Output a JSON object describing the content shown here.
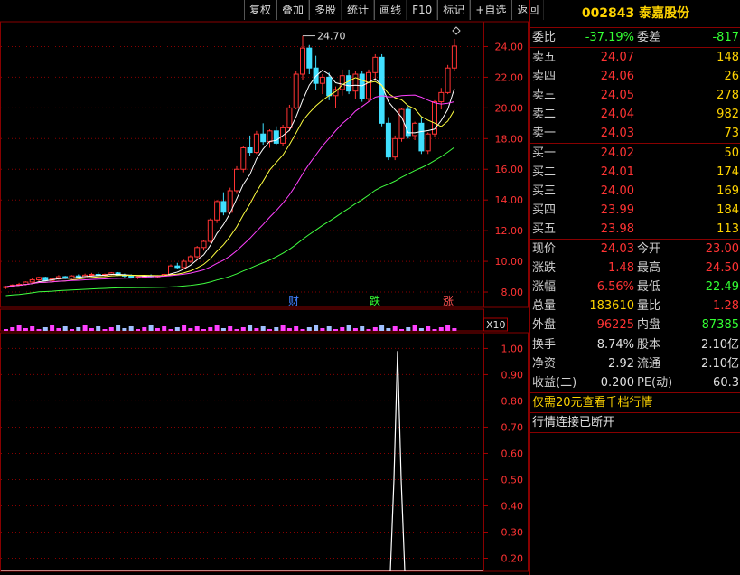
{
  "toolbar": {
    "items": [
      "复权",
      "叠加",
      "多股",
      "统计",
      "画线",
      "F10",
      "标记",
      "+自选",
      "返回"
    ]
  },
  "chart": {
    "max_label": "24.70",
    "diamond_icon": "diamond-icon",
    "price_axis": [
      "24.00",
      "22.00",
      "20.00",
      "18.00",
      "16.00",
      "14.00",
      "12.00",
      "10.00",
      "8.00"
    ],
    "event_tags": [
      {
        "text": "财",
        "color": "#4080ff"
      },
      {
        "text": "跌",
        "color": "#33ff33"
      },
      {
        "text": "涨",
        "color": "#ff5050"
      }
    ],
    "lower_panel_label": "X10",
    "lower_axis": [
      "1.00",
      "0.90",
      "0.80",
      "0.70",
      "0.60",
      "0.50",
      "0.40",
      "0.30",
      "0.20"
    ],
    "colors": {
      "up": "#ff3333",
      "down": "#40e0ff",
      "ma5": "#ffffff",
      "ma10": "#ffff40",
      "ma20": "#ff40ff",
      "ma60": "#40ff40"
    }
  },
  "chart_data": {
    "type": "candlestick",
    "ylim": [
      7.0,
      25.5
    ],
    "candles": [
      [
        8.3,
        8.4,
        8.2,
        8.35
      ],
      [
        8.35,
        8.5,
        8.3,
        8.45
      ],
      [
        8.45,
        8.6,
        8.4,
        8.5
      ],
      [
        8.5,
        8.7,
        8.45,
        8.65
      ],
      [
        8.65,
        8.9,
        8.6,
        8.8
      ],
      [
        8.8,
        9.0,
        8.7,
        8.95
      ],
      [
        8.95,
        9.0,
        8.7,
        8.75
      ],
      [
        8.75,
        8.9,
        8.7,
        8.85
      ],
      [
        8.85,
        9.1,
        8.8,
        9.0
      ],
      [
        9.0,
        9.05,
        8.85,
        8.9
      ],
      [
        8.9,
        9.1,
        8.85,
        9.05
      ],
      [
        9.05,
        9.15,
        8.95,
        9.0
      ],
      [
        9.0,
        9.2,
        8.95,
        9.1
      ],
      [
        9.1,
        9.25,
        9.0,
        9.15
      ],
      [
        9.15,
        9.3,
        9.05,
        9.1
      ],
      [
        9.1,
        9.2,
        9.0,
        9.15
      ],
      [
        9.15,
        9.3,
        9.1,
        9.25
      ],
      [
        9.25,
        9.3,
        9.05,
        9.1
      ],
      [
        9.1,
        9.2,
        8.95,
        9.05
      ],
      [
        9.05,
        9.15,
        8.9,
        8.95
      ],
      [
        8.95,
        9.05,
        8.85,
        9.0
      ],
      [
        9.0,
        9.1,
        8.9,
        9.05
      ],
      [
        9.05,
        9.15,
        8.95,
        9.0
      ],
      [
        9.0,
        9.1,
        8.9,
        9.05
      ],
      [
        9.05,
        9.2,
        9.0,
        9.15
      ],
      [
        9.15,
        9.8,
        9.1,
        9.7
      ],
      [
        9.7,
        9.9,
        9.5,
        9.6
      ],
      [
        9.6,
        10.1,
        9.55,
        10.0
      ],
      [
        10.0,
        10.4,
        9.9,
        10.3
      ],
      [
        10.3,
        11.0,
        10.2,
        10.9
      ],
      [
        10.9,
        11.4,
        10.7,
        11.3
      ],
      [
        11.3,
        12.8,
        11.2,
        12.7
      ],
      [
        12.7,
        14.0,
        12.5,
        13.9
      ],
      [
        13.9,
        14.5,
        13.0,
        13.2
      ],
      [
        13.2,
        14.8,
        13.1,
        14.6
      ],
      [
        14.6,
        16.2,
        14.4,
        16.0
      ],
      [
        16.0,
        17.5,
        15.8,
        17.4
      ],
      [
        17.4,
        18.2,
        16.9,
        17.1
      ],
      [
        17.1,
        18.5,
        17.0,
        18.3
      ],
      [
        18.3,
        19.0,
        17.6,
        17.8
      ],
      [
        17.8,
        18.6,
        17.4,
        18.5
      ],
      [
        18.5,
        18.8,
        17.6,
        17.7
      ],
      [
        17.7,
        18.9,
        17.5,
        18.7
      ],
      [
        18.7,
        20.2,
        18.5,
        20.0
      ],
      [
        20.0,
        22.4,
        19.9,
        22.2
      ],
      [
        22.2,
        24.7,
        21.8,
        23.9
      ],
      [
        23.9,
        24.1,
        22.2,
        22.6
      ],
      [
        22.6,
        23.4,
        21.2,
        21.6
      ],
      [
        21.6,
        22.2,
        20.9,
        22.0
      ],
      [
        22.0,
        22.3,
        20.5,
        20.8
      ],
      [
        20.8,
        21.4,
        20.0,
        21.2
      ],
      [
        21.2,
        22.5,
        20.8,
        22.1
      ],
      [
        22.1,
        22.5,
        20.9,
        21.1
      ],
      [
        21.1,
        22.4,
        20.6,
        22.2
      ],
      [
        22.2,
        22.4,
        20.4,
        20.6
      ],
      [
        20.6,
        22.5,
        20.4,
        22.3
      ],
      [
        22.3,
        23.5,
        21.8,
        23.3
      ],
      [
        23.3,
        23.5,
        18.8,
        19.0
      ],
      [
        19.0,
        19.4,
        16.6,
        16.8
      ],
      [
        16.8,
        18.2,
        16.6,
        18.0
      ],
      [
        18.0,
        20.0,
        17.8,
        19.9
      ],
      [
        19.9,
        20.1,
        18.0,
        18.2
      ],
      [
        18.2,
        19.1,
        17.9,
        19.0
      ],
      [
        19.0,
        19.4,
        17.0,
        17.2
      ],
      [
        17.2,
        18.4,
        17.0,
        18.3
      ],
      [
        18.3,
        20.5,
        18.1,
        20.4
      ],
      [
        20.4,
        21.3,
        19.9,
        21.0
      ],
      [
        21.0,
        22.8,
        20.9,
        22.6
      ],
      [
        22.6,
        24.5,
        22.4,
        24.03
      ]
    ],
    "markers": [
      [
        0.95,
        0.01
      ]
    ]
  },
  "quote": {
    "title": "002843 泰嘉股份",
    "wei_bi": {
      "label": "委比",
      "value": "-37.19%",
      "label2": "委差",
      "value2": "-817"
    },
    "sell": [
      {
        "label": "卖五",
        "price": "24.07",
        "vol": "148"
      },
      {
        "label": "卖四",
        "price": "24.06",
        "vol": "26"
      },
      {
        "label": "卖三",
        "price": "24.05",
        "vol": "278"
      },
      {
        "label": "卖二",
        "price": "24.04",
        "vol": "982"
      },
      {
        "label": "卖一",
        "price": "24.03",
        "vol": "73"
      }
    ],
    "buy": [
      {
        "label": "买一",
        "price": "24.02",
        "vol": "50"
      },
      {
        "label": "买二",
        "price": "24.01",
        "vol": "174"
      },
      {
        "label": "买三",
        "price": "24.00",
        "vol": "169"
      },
      {
        "label": "买四",
        "price": "23.99",
        "vol": "184"
      },
      {
        "label": "买五",
        "price": "23.98",
        "vol": "113"
      }
    ],
    "stats": [
      {
        "l1": "现价",
        "v1": "24.03",
        "c1": "red",
        "l2": "今开",
        "v2": "23.00",
        "c2": "red"
      },
      {
        "l1": "涨跌",
        "v1": "1.48",
        "c1": "red",
        "l2": "最高",
        "v2": "24.50",
        "c2": "red"
      },
      {
        "l1": "涨幅",
        "v1": "6.56%",
        "c1": "red",
        "l2": "最低",
        "v2": "22.49",
        "c2": "green"
      },
      {
        "l1": "总量",
        "v1": "183610",
        "c1": "yellow",
        "l2": "量比",
        "v2": "1.28",
        "c2": "red"
      },
      {
        "l1": "外盘",
        "v1": "96225",
        "c1": "red",
        "l2": "内盘",
        "v2": "87385",
        "c2": "green"
      }
    ],
    "stats2": [
      {
        "l1": "换手",
        "v1": "8.74%",
        "l2": "股本",
        "v2": "2.10亿"
      },
      {
        "l1": "净资",
        "v1": "2.92",
        "l2": "流通",
        "v2": "2.10亿"
      },
      {
        "l1": "收益(二)",
        "v1": "0.200",
        "l2": "PE(动)",
        "v2": "60.3"
      }
    ],
    "promo": "仅需20元查看千档行情",
    "status": "行情连接已断开"
  }
}
